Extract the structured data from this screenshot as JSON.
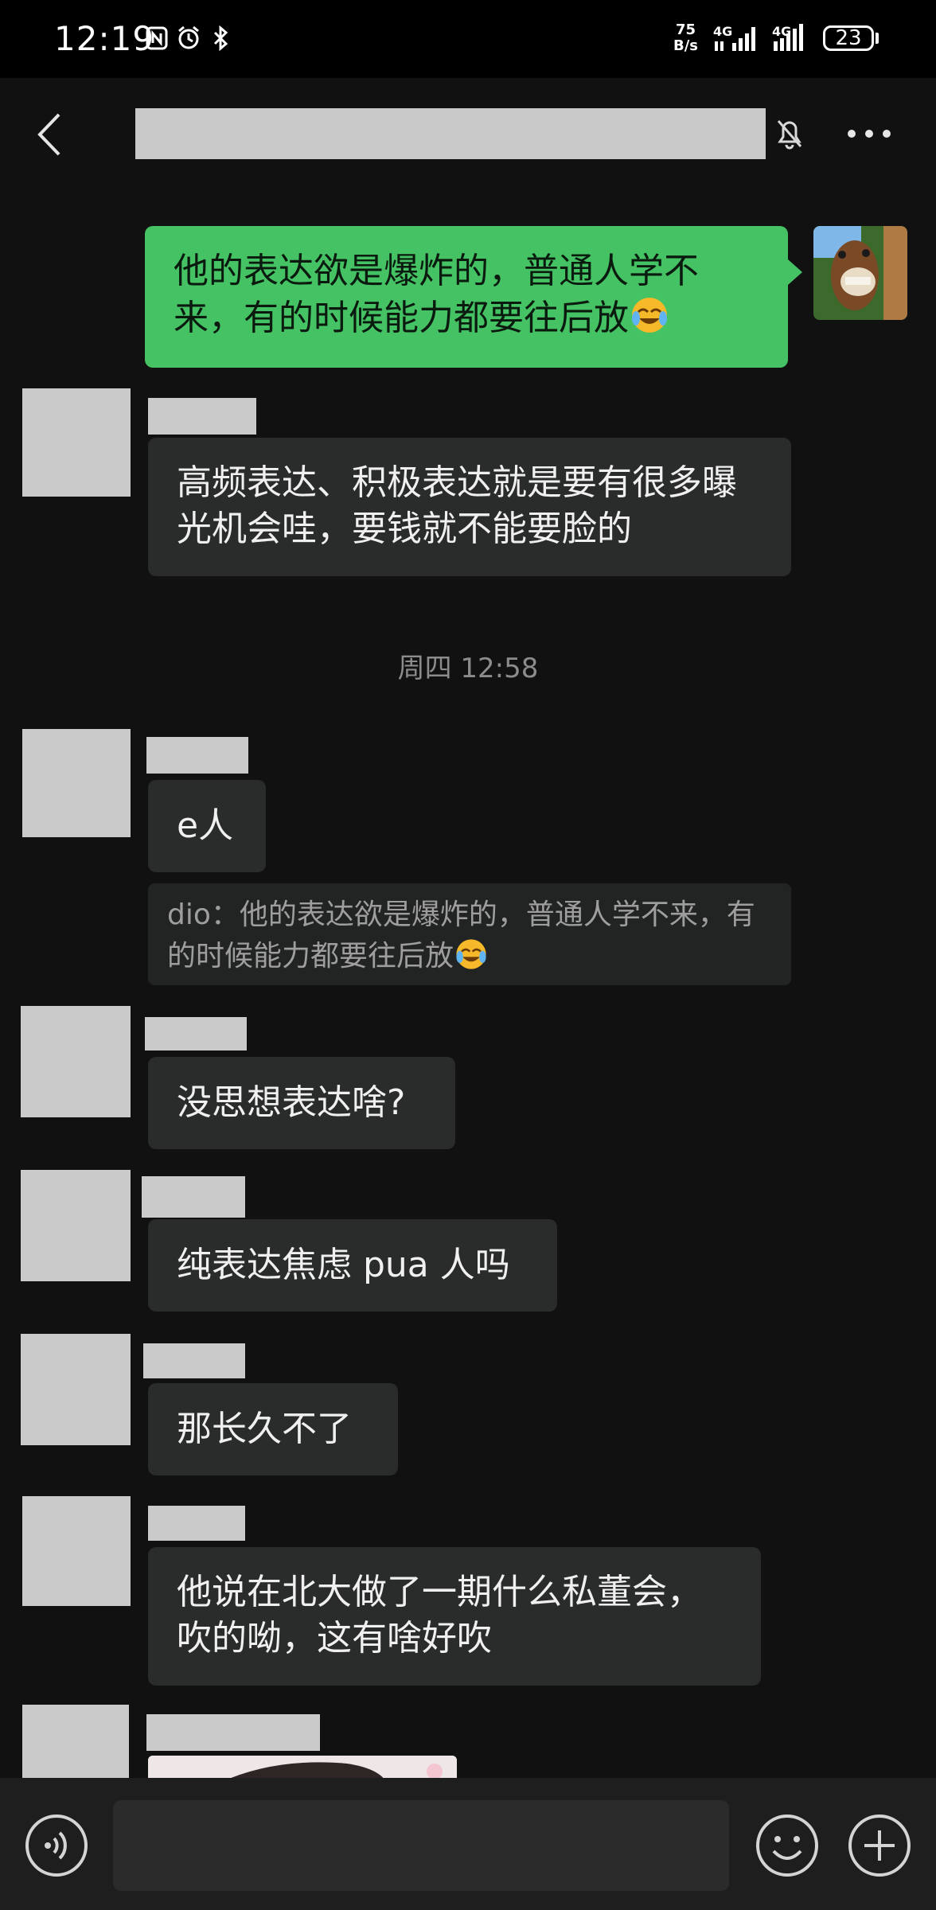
{
  "status_bar": {
    "time": "12:19",
    "speed_value": "75",
    "speed_unit": "B/s",
    "signal_1_label": "4G",
    "signal_2_label": "4G",
    "battery": "23"
  },
  "header": {
    "icons": [
      "back-icon",
      "mute-icon",
      "more-icon"
    ]
  },
  "messages": {
    "m1": "他的表达欲是爆炸的，普通人学不来，有的时候能力都要往后放",
    "m2": "高频表达、积极表达就是要有很多曝光机会哇，要钱就不能要脸的",
    "time_divider": "周四 12:58",
    "m3": "e人",
    "m3_quote": "dio：他的表达欲是爆炸的，普通人学不来，有的时候能力都要往后放",
    "m4": "没思想表达啥?",
    "m5": "纯表达焦虑 pua 人吗",
    "m6": "那长久不了",
    "m7": "他说在北大做了一期什么私董会，吹的呦，这有啥好吹"
  },
  "input_bar": {
    "placeholder": "",
    "icons": [
      "voice-icon",
      "emoji-icon",
      "plus-icon"
    ]
  },
  "colors": {
    "background": "#111111",
    "my_bubble": "#45c264",
    "other_bubble": "#2a2b2b",
    "redaction": "#cacaca"
  }
}
